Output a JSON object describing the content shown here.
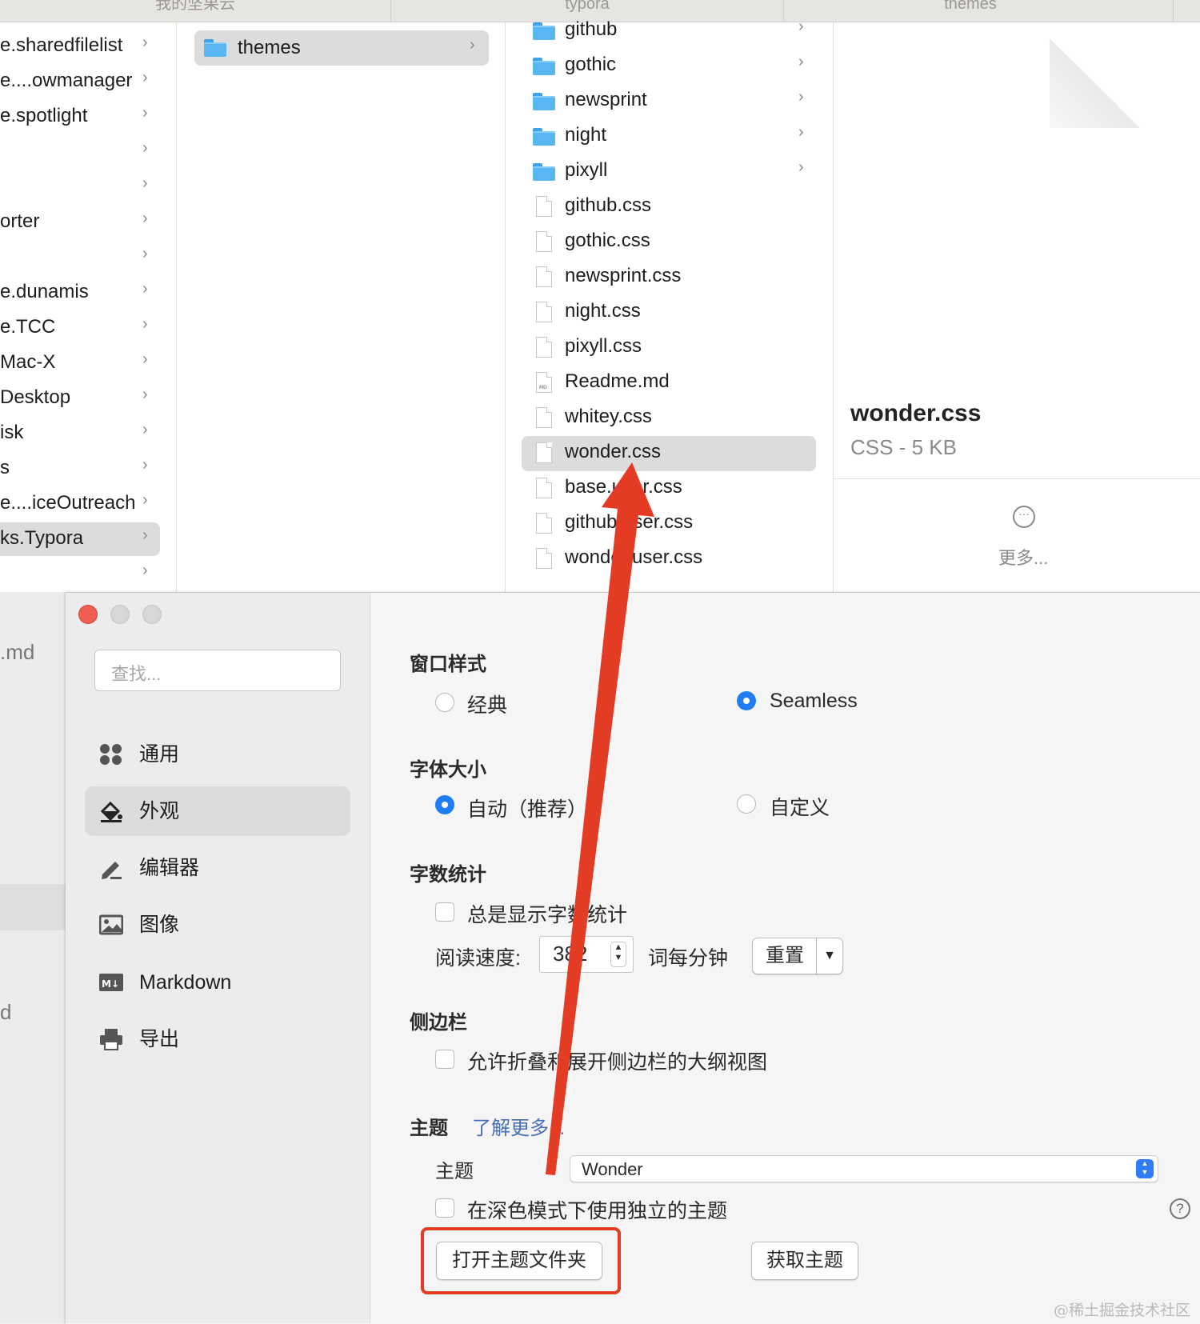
{
  "finder": {
    "tabs": [
      "我的坚果云",
      "typora",
      "themes"
    ],
    "col1_items": [
      {
        "label": "e.sharedfilelist"
      },
      {
        "label": "e....owmanager"
      },
      {
        "label": "e.spotlight"
      },
      {
        "label": ""
      },
      {
        "label": ""
      },
      {
        "label": "orter"
      },
      {
        "label": ""
      },
      {
        "label": "e.dunamis"
      },
      {
        "label": "e.TCC"
      },
      {
        "label": "Mac-X"
      },
      {
        "label": "Desktop"
      },
      {
        "label": "isk"
      },
      {
        "label": "s"
      },
      {
        "label": "e....iceOutreach"
      },
      {
        "label": "ks.Typora",
        "selected": true
      },
      {
        "label": ""
      }
    ],
    "col2_items": [
      {
        "label": "themes",
        "selected": true
      }
    ],
    "col3_items": [
      {
        "label": "github",
        "type": "folder"
      },
      {
        "label": "gothic",
        "type": "folder"
      },
      {
        "label": "newsprint",
        "type": "folder"
      },
      {
        "label": "night",
        "type": "folder"
      },
      {
        "label": "pixyll",
        "type": "folder"
      },
      {
        "label": "github.css",
        "type": "file"
      },
      {
        "label": "gothic.css",
        "type": "file"
      },
      {
        "label": "newsprint.css",
        "type": "file"
      },
      {
        "label": "night.css",
        "type": "file"
      },
      {
        "label": "pixyll.css",
        "type": "file"
      },
      {
        "label": "Readme.md",
        "type": "md"
      },
      {
        "label": "whitey.css",
        "type": "file"
      },
      {
        "label": "wonder.css",
        "type": "file",
        "selected": true
      },
      {
        "label": "base.user.css",
        "type": "file"
      },
      {
        "label": "github.user.css",
        "type": "file"
      },
      {
        "label": "wonder.user.css",
        "type": "file"
      }
    ],
    "preview": {
      "file_name": "wonder.css",
      "file_info": "CSS - 5 KB",
      "more_label": "更多..."
    }
  },
  "partial_labels": {
    "left_md": ".md",
    "left_d": "d"
  },
  "prefs": {
    "search_placeholder": "查找...",
    "nav": [
      {
        "label": "通用",
        "icon": "grid-icon"
      },
      {
        "label": "外观",
        "icon": "paint-bucket-icon",
        "selected": true
      },
      {
        "label": "编辑器",
        "icon": "pencil-icon"
      },
      {
        "label": "图像",
        "icon": "image-icon"
      },
      {
        "label": "Markdown",
        "icon": "markdown-icon"
      },
      {
        "label": "导出",
        "icon": "printer-icon"
      }
    ],
    "window_style": {
      "title": "窗口样式",
      "option_classic": "经典",
      "option_seamless": "Seamless",
      "selected": "Seamless"
    },
    "font_size": {
      "title": "字体大小",
      "option_auto": "自动（推荐）",
      "option_custom": "自定义",
      "selected": "自动（推荐）"
    },
    "word_count": {
      "title": "字数统计",
      "always_show": "总是显示字数统计",
      "reading_speed_label": "阅读速度:",
      "reading_speed_value": "382",
      "unit": "词每分钟",
      "reset_button": "重置"
    },
    "sidebar": {
      "title": "侧边栏",
      "allow_fold": "允许折叠和展开侧边栏的大纲视图"
    },
    "theme": {
      "title": "主题",
      "learn_more": "了解更多...",
      "theme_label": "主题",
      "theme_value": "Wonder",
      "dark_mode_separate": "在深色模式下使用独立的主题",
      "open_folder_button": "打开主题文件夹",
      "get_themes_button": "获取主题"
    }
  },
  "annotation_colors": {
    "arrow": "#e43b25",
    "highlight_box": "#e43b25"
  },
  "watermark": "@稀土掘金技术社区"
}
